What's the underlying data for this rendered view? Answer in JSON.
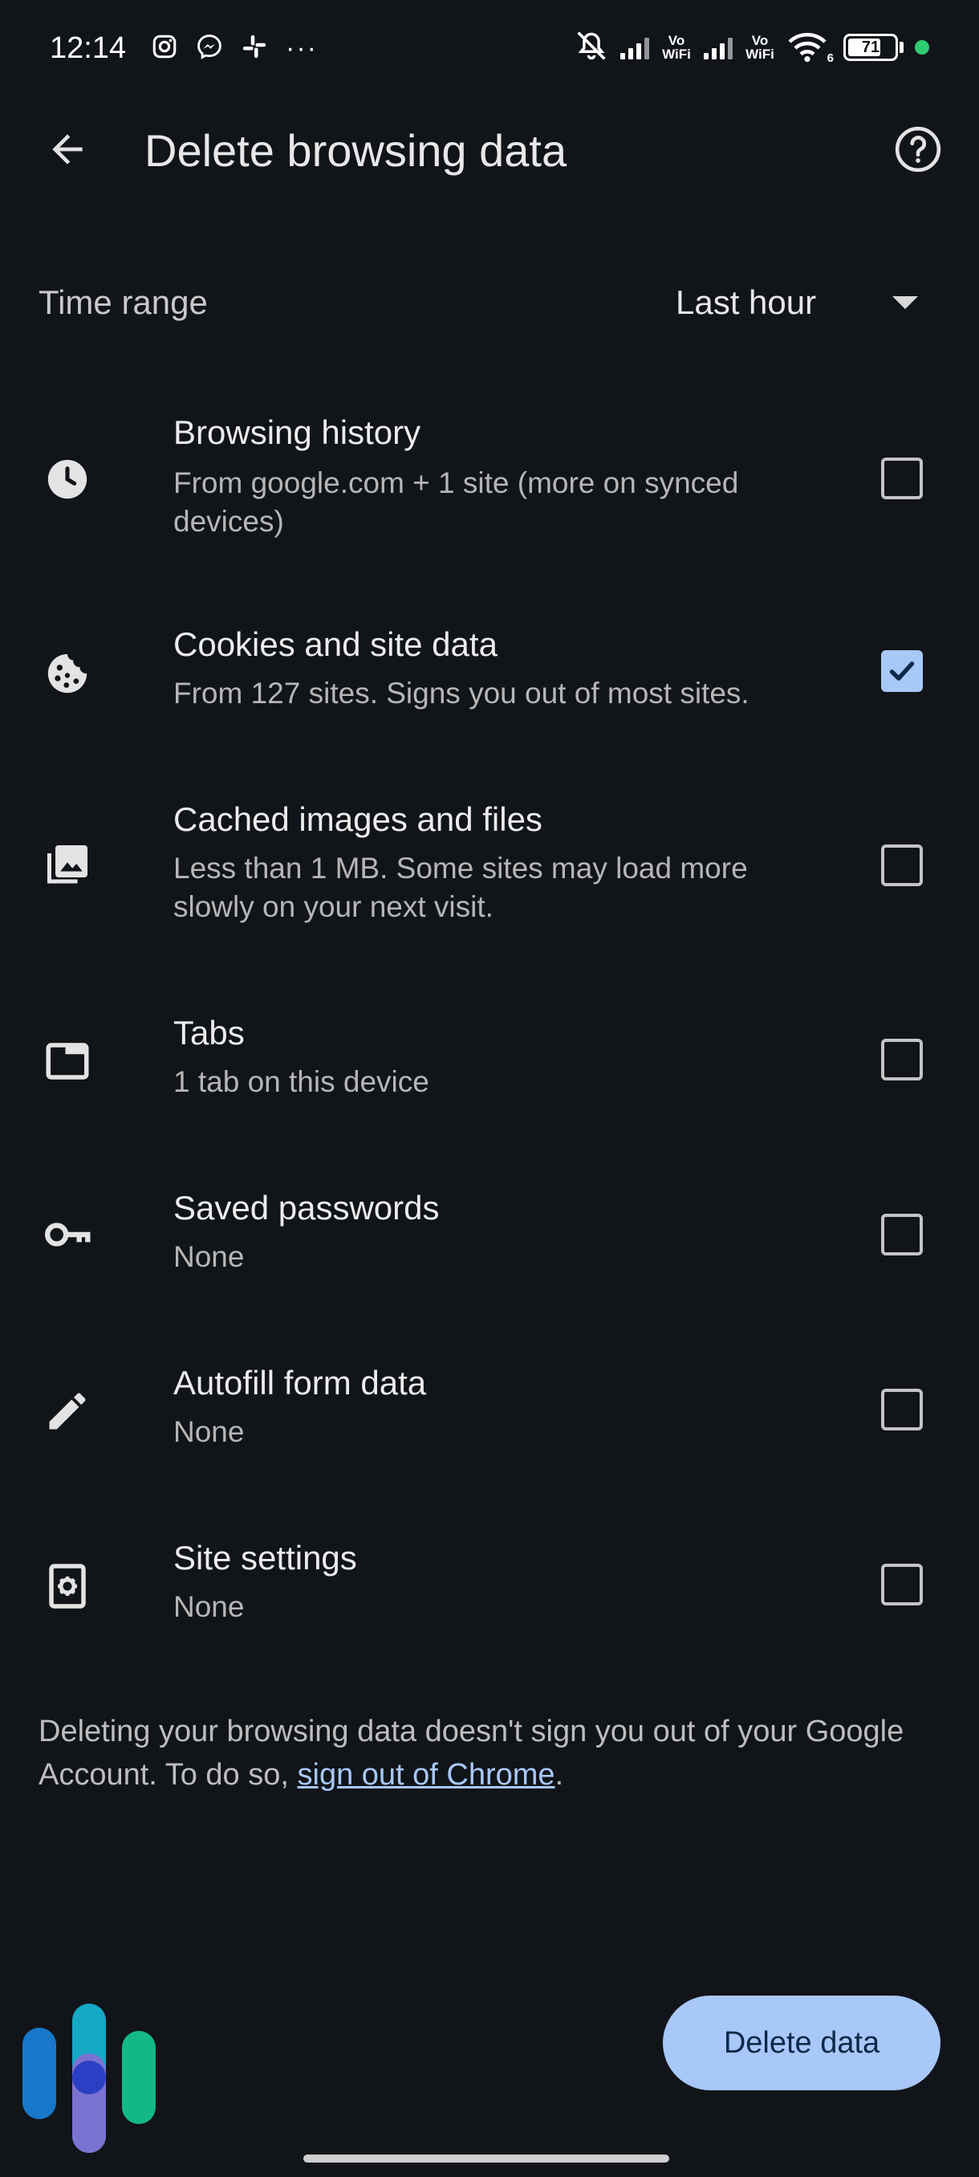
{
  "status_bar": {
    "time": "12:14",
    "left_icons": [
      "instagram-icon",
      "messenger-icon",
      "slack-icon",
      "more-notifications-icon"
    ],
    "more_dots": "···",
    "vowifi_label": "Vo WiFi",
    "wifi_label": "6",
    "battery_level": "71",
    "battery_fraction": 0.71
  },
  "app_bar": {
    "title": "Delete browsing data",
    "back_icon": "arrow-back-icon",
    "help_icon": "help-icon"
  },
  "time_range": {
    "label": "Time range",
    "value": "Last hour"
  },
  "items": [
    {
      "icon": "clock-icon",
      "title": "Browsing history",
      "subtitle": "From google.com + 1 site (more on synced devices)",
      "checked": false
    },
    {
      "icon": "cookie-icon",
      "title": "Cookies and site data",
      "subtitle": "From 127 sites. Signs you out of most sites.",
      "checked": true
    },
    {
      "icon": "image-icon",
      "title": "Cached images and files",
      "subtitle": "Less than 1 MB. Some sites may load more slowly on your next visit.",
      "checked": false
    },
    {
      "icon": "tab-icon",
      "title": "Tabs",
      "subtitle": "1 tab on this device",
      "checked": false
    },
    {
      "icon": "key-icon",
      "title": "Saved passwords",
      "subtitle": "None",
      "checked": false
    },
    {
      "icon": "pencil-icon",
      "title": "Autofill form data",
      "subtitle": "None",
      "checked": false
    },
    {
      "icon": "settings-icon",
      "title": "Site settings",
      "subtitle": "None",
      "checked": false
    }
  ],
  "footer": {
    "text_before": "Deleting your browsing data doesn't sign you out of your Google Account. To do so, ",
    "link": "sign out of Chrome",
    "text_after": "."
  },
  "delete_button": {
    "label": "Delete data"
  },
  "colors": {
    "background": "#111418",
    "accent": "#a8c8fa",
    "button_text": "#0b2a4a"
  }
}
